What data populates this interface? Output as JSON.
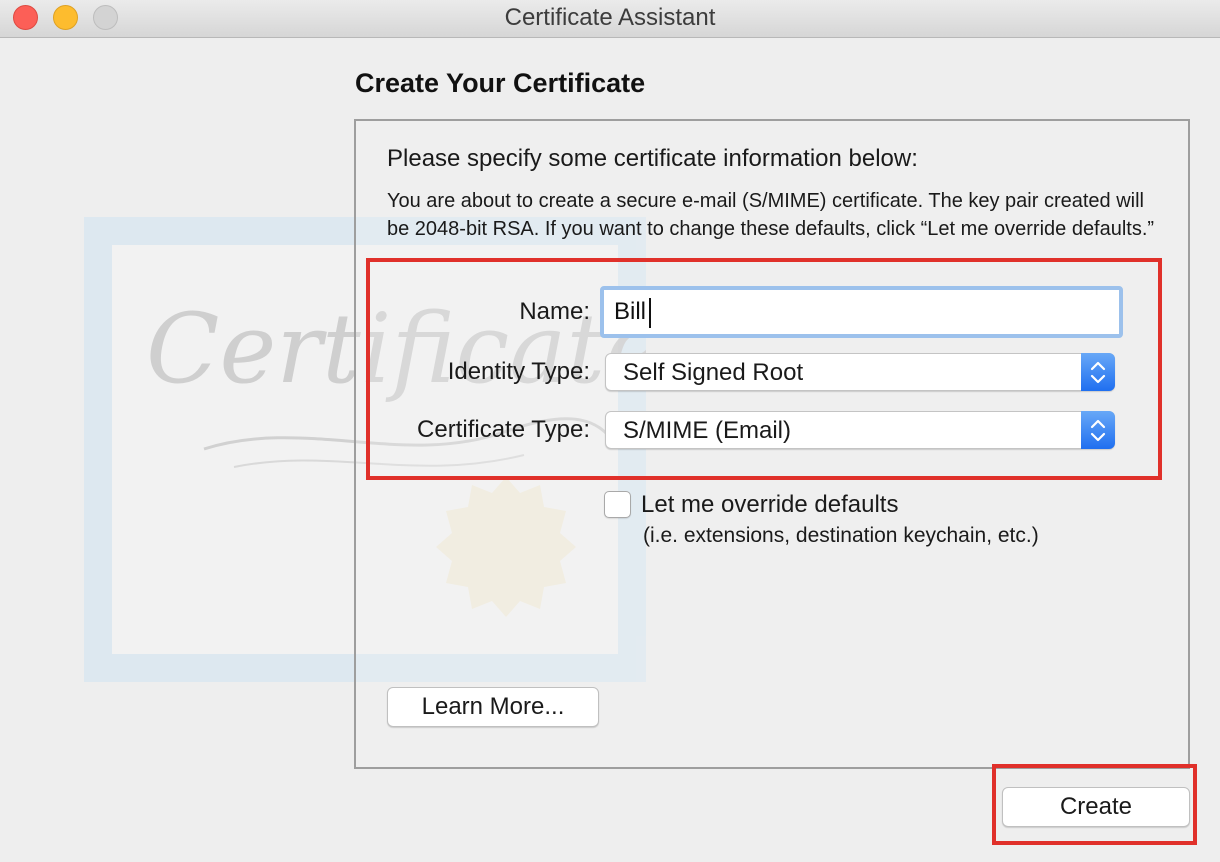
{
  "window": {
    "title": "Certificate Assistant"
  },
  "illustration": {
    "script_text": "Certificate"
  },
  "main": {
    "heading": "Create Your Certificate",
    "prompt": "Please specify some certificate information below:",
    "description": "You are about to create a secure e-mail (S/MIME) certificate. The key pair created will be 2048-bit RSA. If you want to change these defaults, click “Let me override defaults.”"
  },
  "form": {
    "name_label": "Name:",
    "name_value": "Bill",
    "identity_type_label": "Identity Type:",
    "identity_type_value": "Self Signed Root",
    "certificate_type_label": "Certificate Type:",
    "certificate_type_value": "S/MIME (Email)"
  },
  "override": {
    "label": "Let me override defaults",
    "sublabel": "(i.e. extensions, destination keychain, etc.)",
    "checked": false
  },
  "buttons": {
    "learn_more": "Learn More...",
    "create": "Create"
  },
  "colors": {
    "highlight": "#e0302a",
    "accent": "#1f6ff0",
    "focus_ring": "#9cc1ec",
    "close": "#fc5f57",
    "minimize": "#fdbc2e"
  },
  "icons": {
    "stepper": "up-down-chevron-icon",
    "seal": "certificate-seal-icon"
  }
}
